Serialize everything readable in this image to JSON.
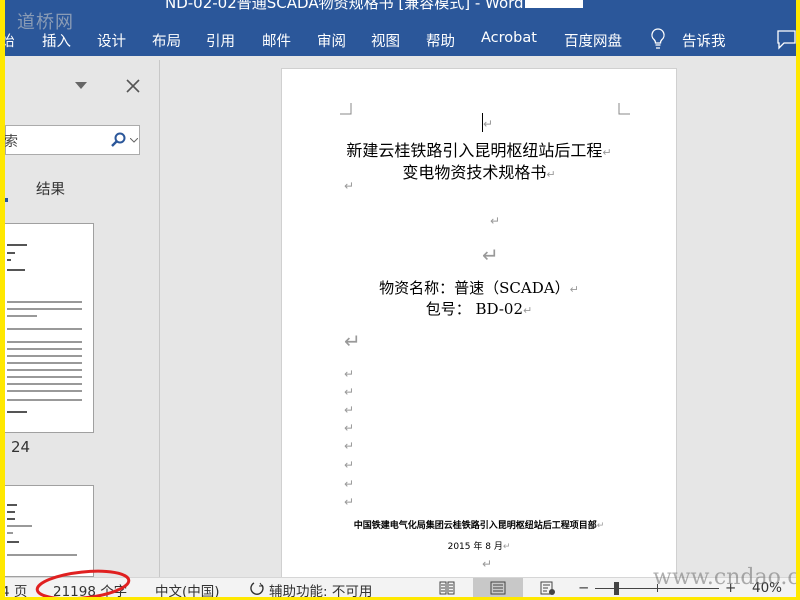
{
  "titlebar": {
    "title": "ND-02-02普通SCADA物资规格书 [兼容模式] - Word"
  },
  "watermarks": {
    "logo": "道桥网",
    "site": "www.cndao.com"
  },
  "ribbon": {
    "tabs": [
      "始",
      "插入",
      "设计",
      "布局",
      "引用",
      "邮件",
      "审阅",
      "视图",
      "帮助",
      "Acrobat",
      "百度网盘"
    ],
    "tell_me": "告诉我"
  },
  "nav": {
    "search_value": "索",
    "results_tab": "结果",
    "page_label": "24"
  },
  "document": {
    "title_line1": "新建云桂铁路引入昆明枢纽站后工程",
    "title_line2": "变电物资技术规格书",
    "material_name": "物资名称：普速（SCADA）",
    "package_no": "包号： BD-02",
    "org": "中国铁建电气化局集团云桂铁路引入昆明枢纽站后工程项目部",
    "date": "2015 年 8 月",
    "para_mark": "↵"
  },
  "status": {
    "page": "4 页",
    "word_count": "21198 个字",
    "language": "中文(中国)",
    "accessibility": "辅助功能: 不可用",
    "zoom_minus": "−",
    "zoom_plus": "+",
    "zoom": "40%",
    "zoom_percent": 40
  },
  "colors": {
    "ribbon": "#2b579a",
    "highlight": "#e02020",
    "frame": "#ffe800"
  }
}
